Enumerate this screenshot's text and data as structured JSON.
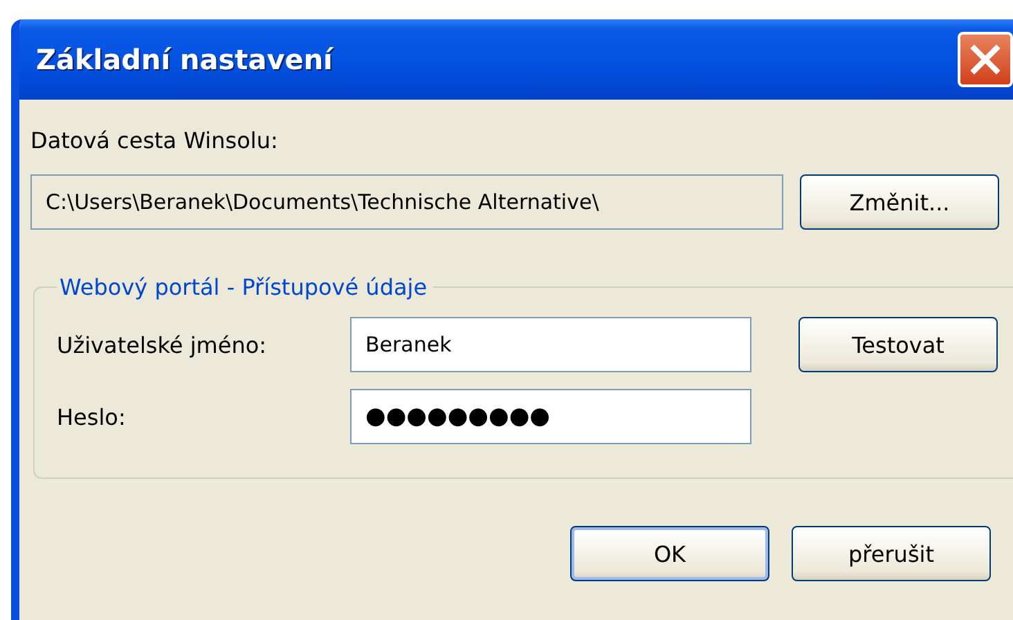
{
  "window": {
    "title": "Základní nastavení"
  },
  "data_path": {
    "label": "Datová cesta Winsolu:",
    "value": "C:\\Users\\Beranek\\Documents\\Technische Alternative\\",
    "button": "Změnit..."
  },
  "web_portal": {
    "legend": "Webový portál - Přístupové údaje",
    "fields": [
      {
        "label": "Uživatelské jméno:",
        "value": "Beranek"
      },
      {
        "label": "Heslo:",
        "value": "●●●●●●●●●"
      }
    ],
    "button": "Testovat"
  },
  "buttons": [
    {
      "label": "OK",
      "default": true
    },
    {
      "label": "přerušit",
      "default": false
    }
  ]
}
